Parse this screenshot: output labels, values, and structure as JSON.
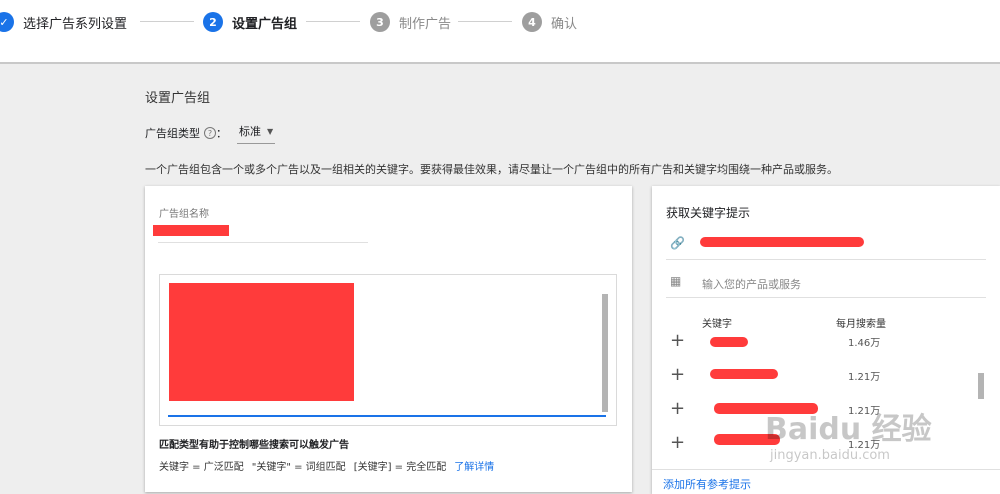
{
  "stepper": {
    "steps": [
      {
        "num": "✓",
        "label": "选择广告系列设置",
        "state": "done"
      },
      {
        "num": "2",
        "label": "设置广告组",
        "state": "active"
      },
      {
        "num": "3",
        "label": "制作广告",
        "state": "inactive"
      },
      {
        "num": "4",
        "label": "确认",
        "state": "inactive"
      }
    ]
  },
  "main": {
    "title": "设置广告组",
    "type_label": "广告组类型",
    "help_icon": "?",
    "type_separator": "：",
    "type_value": "标准",
    "description": "一个广告组包含一个或多个广告以及一组相关的关键字。要获得最佳效果，请尽量让一个广告组中的所有广告和关键字均围绕一种产品或服务。"
  },
  "left_card": {
    "name_label": "广告组名称",
    "match_title": "匹配类型有助于控制哪些搜索可以触发广告",
    "match_broad": "关键字 = 广泛匹配",
    "match_phrase": "\"关键字\" = 词组匹配",
    "match_exact": "[关键字] = 完全匹配",
    "learn_more": "了解详情"
  },
  "right_card": {
    "title": "获取关键字提示",
    "url_icon": "link-icon",
    "product_icon": "building-icon",
    "product_placeholder": "输入您的产品或服务",
    "col_keyword": "关键字",
    "col_volume": "每月搜索量",
    "rows": [
      {
        "plus": "+",
        "volume": "1.46万"
      },
      {
        "plus": "+",
        "volume": "1.21万"
      },
      {
        "plus": "+",
        "volume": "1.21万"
      },
      {
        "plus": "+",
        "volume": "1.21万"
      }
    ],
    "add_all": "添加所有参考提示"
  },
  "watermark": {
    "text": "Baidu 经验",
    "sub": "jingyan.baidu.com"
  },
  "colors": {
    "accent": "#1a73e8",
    "redaction": "#ff3b3b",
    "inactive_step": "#9e9e9e"
  }
}
